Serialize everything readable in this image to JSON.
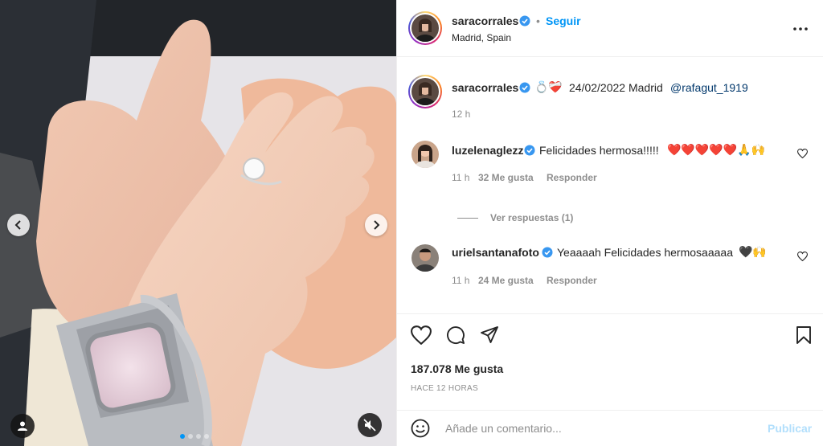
{
  "post": {
    "author": {
      "username": "saracorrales",
      "location": "Madrid, Spain",
      "follow_label": "Seguir",
      "separator": "•"
    },
    "caption": {
      "username": "saracorrales",
      "emojis": "💍❤️‍🩹",
      "text": "24/02/2022 Madrid",
      "mention": "@rafagut_1919",
      "time": "12 h"
    },
    "comments": [
      {
        "username": "luzelenaglezz",
        "text": "Felicidades hermosa!!!!!",
        "emojis": "❤️❤️❤️❤️❤️🙏🙌",
        "time": "11 h",
        "likes": "32 Me gusta",
        "reply_label": "Responder",
        "view_replies": "Ver respuestas (1)"
      },
      {
        "username": "urielsantanafoto",
        "text": "Yeaaaah Felicidades hermosaaaaa",
        "emojis": "🖤🙌",
        "time": "11 h",
        "likes": "24 Me gusta",
        "reply_label": "Responder"
      }
    ],
    "likes_count": "187.078 Me gusta",
    "time_ago": "HACE 12 HORAS",
    "add_comment": {
      "placeholder": "Añade un comentario...",
      "submit_label": "Publicar"
    },
    "carousel": {
      "total": 4,
      "current": 1
    }
  },
  "icons": {
    "more": "more-options-icon",
    "like": "heart-icon",
    "comment": "comment-icon",
    "share": "share-icon",
    "save": "bookmark-icon",
    "emoji": "smiley-icon",
    "prev": "chevron-left-icon",
    "next": "chevron-right-icon",
    "tag": "user-tag-icon",
    "mute": "mute-icon"
  },
  "colors": {
    "accent": "#0095f6",
    "link": "#00376b",
    "muted": "#8e8e8e",
    "verified": "#3897f0",
    "publish_disabled": "#b2dffc"
  }
}
